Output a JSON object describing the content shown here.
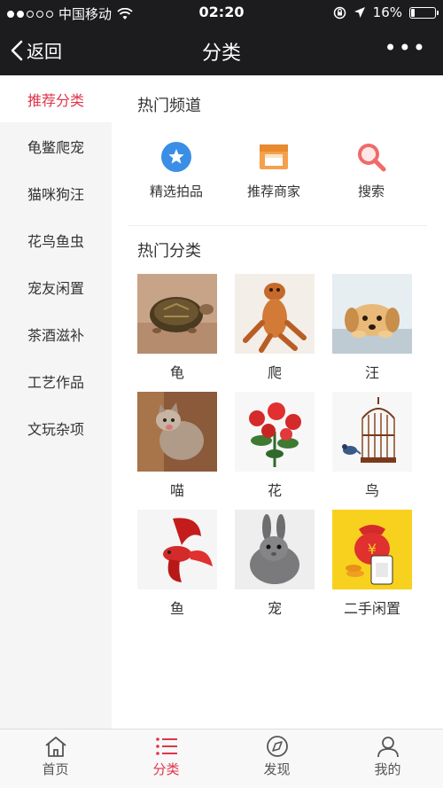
{
  "status_bar": {
    "carrier": "中国移动",
    "time": "02:20",
    "battery_percent": "16%",
    "battery_level": 0.16
  },
  "navbar": {
    "back_label": "返回",
    "title": "分类",
    "more_label": "•••"
  },
  "sidebar": {
    "items": [
      {
        "label": "推荐分类",
        "active": true
      },
      {
        "label": "龟鳖爬宠"
      },
      {
        "label": "猫咪狗汪"
      },
      {
        "label": "花鸟鱼虫"
      },
      {
        "label": "宠友闲置"
      },
      {
        "label": "茶酒滋补"
      },
      {
        "label": "工艺作品"
      },
      {
        "label": "文玩杂项"
      }
    ]
  },
  "hot_channels": {
    "title": "热门频道",
    "items": [
      {
        "label": "精选拍品",
        "icon": "star-icon",
        "color": "#3a8ee6"
      },
      {
        "label": "推荐商家",
        "icon": "shop-icon",
        "color": "#f5a04a"
      },
      {
        "label": "搜索",
        "icon": "search-icon",
        "color": "#f06a6a"
      }
    ]
  },
  "hot_categories": {
    "title": "热门分类",
    "items": [
      {
        "label": "龟",
        "image": "tortoise-image"
      },
      {
        "label": "爬",
        "image": "lizard-image"
      },
      {
        "label": "汪",
        "image": "puppy-image"
      },
      {
        "label": "喵",
        "image": "kitten-image"
      },
      {
        "label": "花",
        "image": "flower-image"
      },
      {
        "label": "鸟",
        "image": "birdcage-image"
      },
      {
        "label": "鱼",
        "image": "fish-image"
      },
      {
        "label": "宠",
        "image": "rabbit-image"
      },
      {
        "label": "二手闲置",
        "image": "money-bag-image"
      }
    ]
  },
  "tabbar": {
    "tabs": [
      {
        "label": "首页",
        "icon": "home-icon"
      },
      {
        "label": "分类",
        "icon": "list-icon",
        "active": true
      },
      {
        "label": "发现",
        "icon": "compass-icon"
      },
      {
        "label": "我的",
        "icon": "user-icon"
      }
    ]
  },
  "colors": {
    "accent": "#e0344a",
    "header_bg": "#1c1c1e",
    "sidebar_bg": "#f5f5f5"
  }
}
